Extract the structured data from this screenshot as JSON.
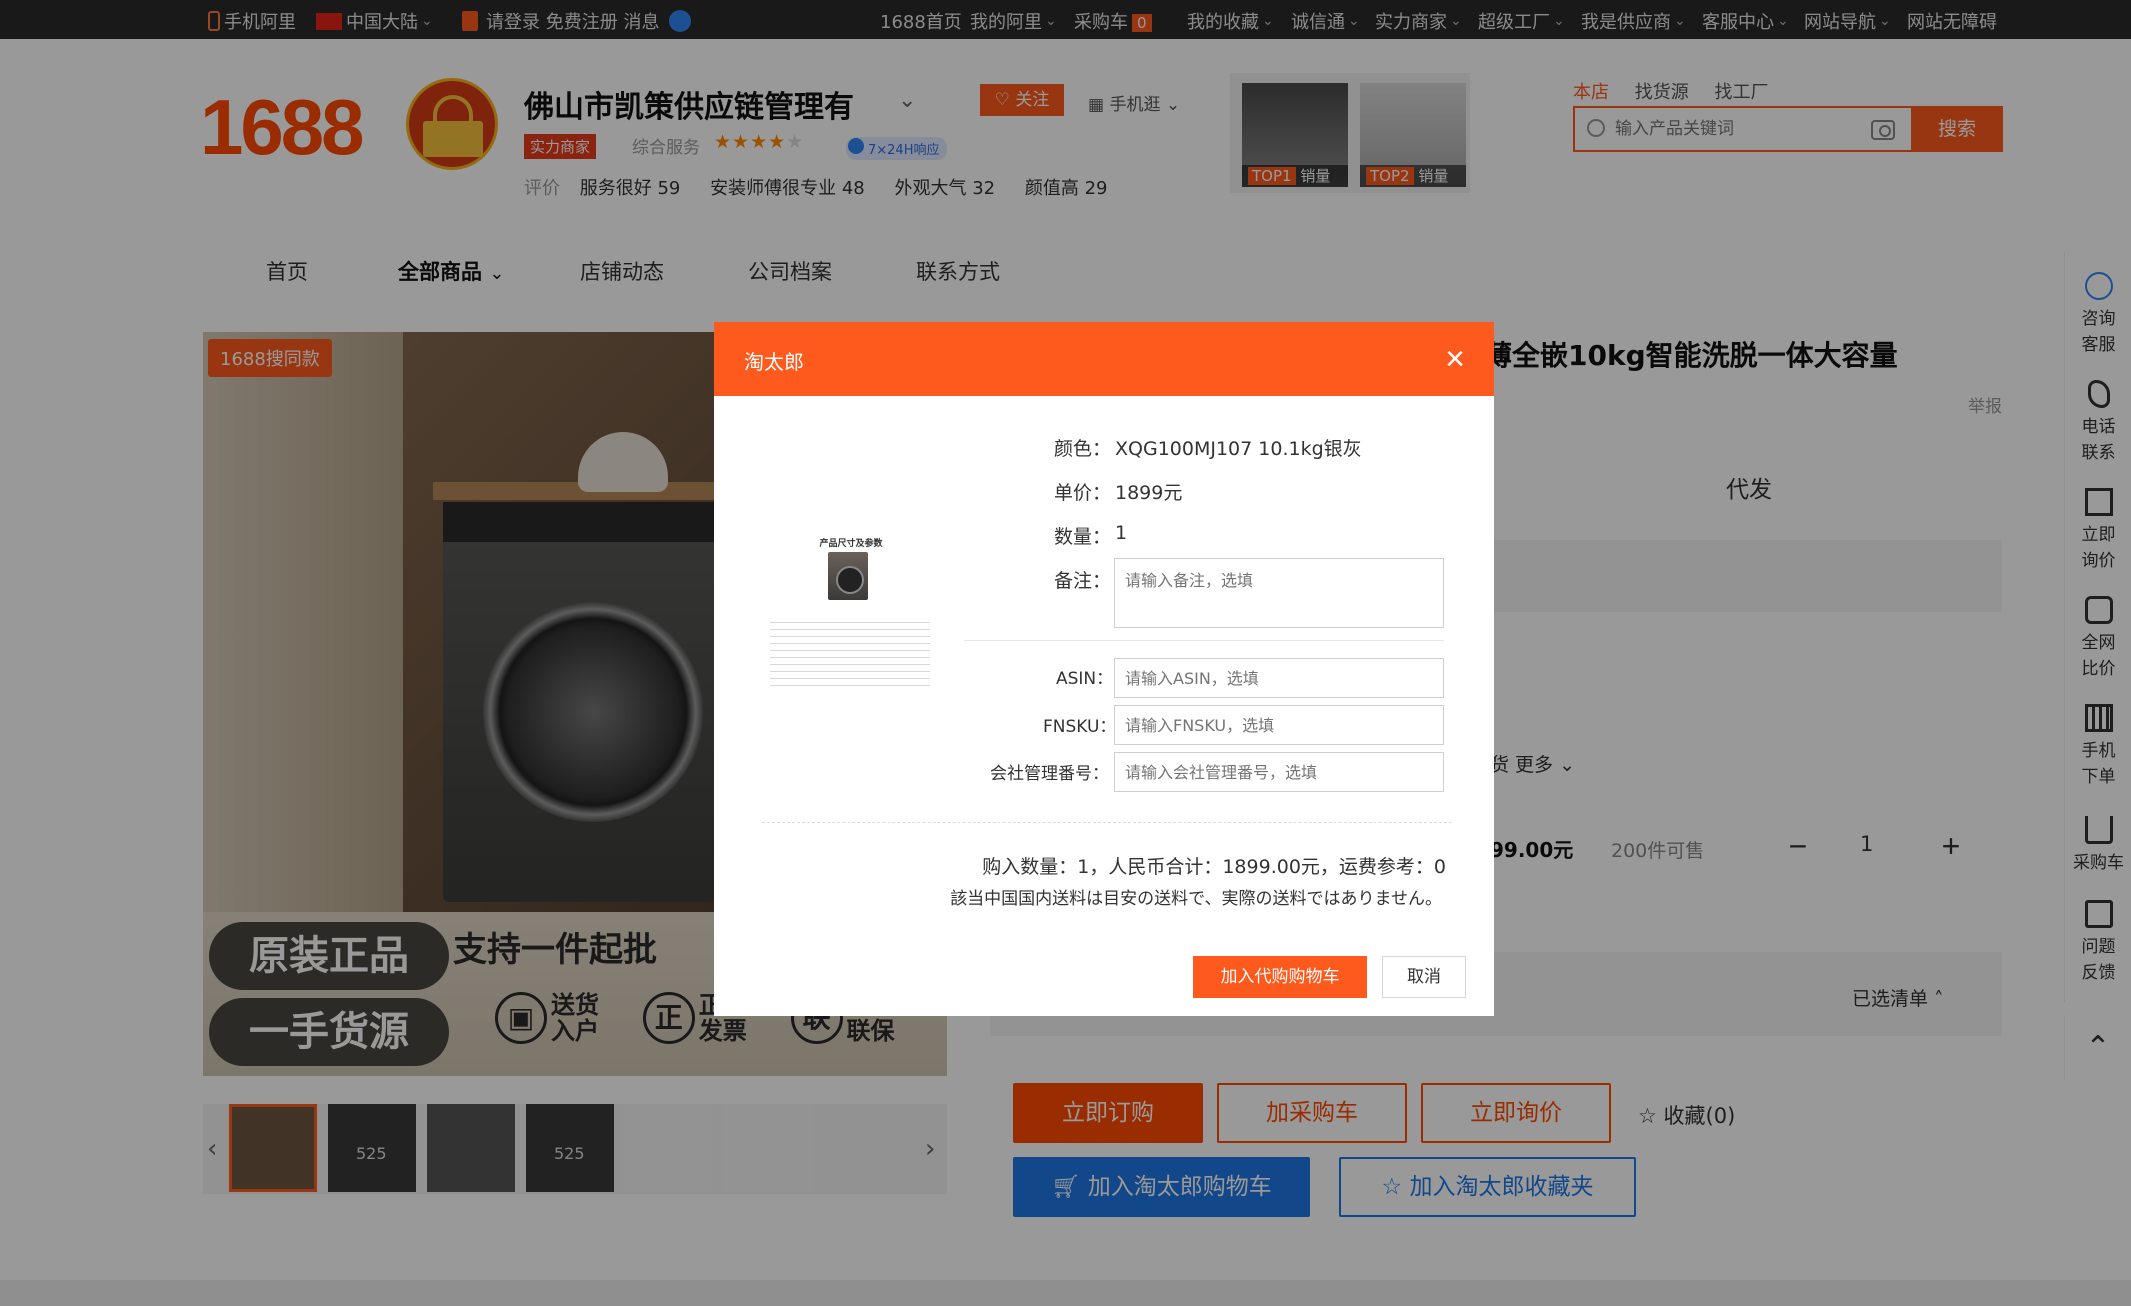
{
  "topbar": {
    "mobile_ali": "手机阿里",
    "region": "中国大陆",
    "login": "请登录",
    "register": "免费注册",
    "messages": "消息",
    "home": "1688首页",
    "my_ali": "我的阿里",
    "cart": "采购车",
    "cart_count": "0",
    "favorites": "我的收藏",
    "chengxintong": "诚信通",
    "strong_merchant": "实力商家",
    "super_factory": "超级工厂",
    "supplier": "我是供应商",
    "service": "客服中心",
    "site_nav": "网站导航",
    "accessible": "网站无障碍"
  },
  "header": {
    "logo": "1688",
    "shop_name": "佛山市凯策供应链管理有",
    "badge_strength": "实力商家",
    "comprehensive_service": "综合服务",
    "stars": "★★★★",
    "stars_dim": "★",
    "badge_247": "7×24H响应",
    "reviews_label": "评价",
    "reviews": [
      {
        "text": "服务很好",
        "count": "59"
      },
      {
        "text": "安装师傅很专业",
        "count": "48"
      },
      {
        "text": "外观大气",
        "count": "32"
      },
      {
        "text": "颜值高",
        "count": "29"
      }
    ],
    "follow": "关注",
    "mobile_browse": "手机逛",
    "top_products": [
      {
        "rank": "TOP1",
        "label": "销量"
      },
      {
        "rank": "TOP2",
        "label": "销量"
      }
    ],
    "search_tabs": [
      "本店",
      "找货源",
      "找工厂"
    ],
    "search_placeholder": "输入产品关键词",
    "search_button": "搜索"
  },
  "nav": {
    "items": [
      "首页",
      "全部商品",
      "店铺动态",
      "公司档案",
      "联系方式"
    ]
  },
  "product": {
    "search_same": "1688搜同款",
    "banner_pill_1": "原装正品",
    "banner_pill_2": "一手货源",
    "banner_text": "支持一件起批",
    "banner_icons": [
      {
        "glyph": "▣",
        "label": "送货入户"
      },
      {
        "glyph": "正",
        "label": "正规发票"
      },
      {
        "glyph": "联",
        "label": "全国联保"
      }
    ],
    "thumb_numbers": [
      "525",
      "525"
    ],
    "title": "超薄全嵌10kg智能洗脱一体大容量",
    "report": "举报",
    "daifa": "代发",
    "more": "货  更多",
    "price": "99.00元",
    "stock": "200件可售",
    "quantity": "1",
    "selected_list": "已选清单",
    "buy_now": "立即订购",
    "add_cart": "加采购车",
    "ask_price": "立即询价",
    "favorite": "收藏(0)",
    "add_taotailang_cart": "加入淘太郎购物车",
    "add_taotailang_fav": "加入淘太郎收藏夹"
  },
  "sidebar": {
    "items": [
      "咨询客服",
      "电话联系",
      "立即询价",
      "全网比价",
      "手机下单",
      "采购车",
      "问题反馈"
    ]
  },
  "modal": {
    "title": "淘太郎",
    "close": "×",
    "image_title": "产品尺寸及参数",
    "color_label": "颜色：",
    "color_value": "XQG100MJ107 10.1kg银灰",
    "price_label": "单价：",
    "price_value": "1899元",
    "qty_label": "数量：",
    "qty_value": "1",
    "remark_label": "备注：",
    "remark_placeholder": "请输入备注，选填",
    "asin_label": "ASIN：",
    "asin_placeholder": "请输入ASIN，选填",
    "fnsku_label": "FNSKU：",
    "fnsku_placeholder": "请输入FNSKU，选填",
    "company_label": "会社管理番号：",
    "company_placeholder": "请输入会社管理番号，选填",
    "summary": "购入数量：1，人民币合计：1899.00元，运费参考：0",
    "note": "該当中国国内送料は目安の送料で、実際の送料ではありません。",
    "add_button": "加入代购购物车",
    "cancel_button": "取消"
  }
}
